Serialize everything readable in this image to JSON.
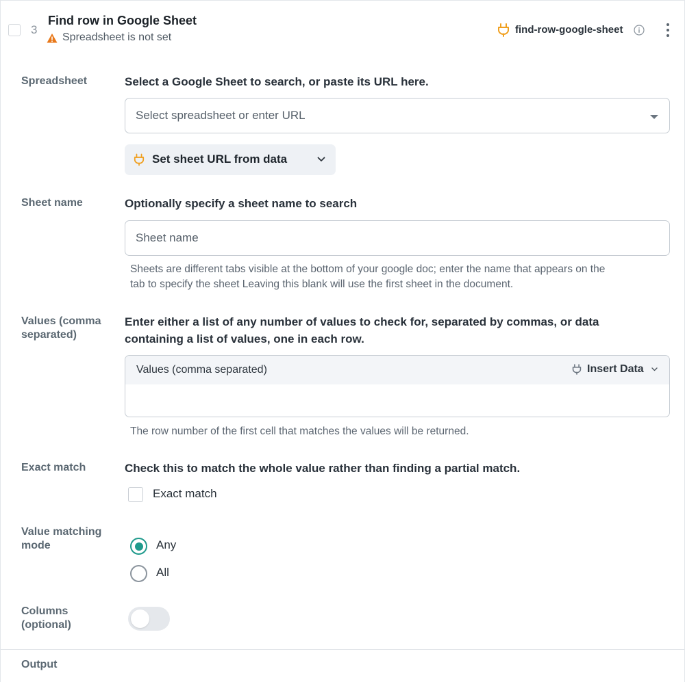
{
  "step": {
    "number": "3",
    "title": "Find row in Google Sheet",
    "warning": "Spreadsheet is not set",
    "slug": "find-row-google-sheet"
  },
  "fields": {
    "spreadsheet": {
      "label": "Spreadsheet",
      "description": "Select a Google Sheet to search, or paste its URL here.",
      "placeholder": "Select spreadsheet or enter URL",
      "data_button": "Set sheet URL from data"
    },
    "sheet_name": {
      "label": "Sheet name",
      "description": "Optionally specify a sheet name to search",
      "placeholder": "Sheet name",
      "help_line1": "Sheets are different tabs visible at the bottom of your google doc; enter the name that appears on the",
      "help_line2": "tab to specify the sheet Leaving this blank will use the first sheet in the document."
    },
    "values": {
      "label_line1": "Values (comma",
      "label_line2": "separated)",
      "description_line1": "Enter either a list of any number of values to check for, separated by commas, or data",
      "description_line2": "containing a list of values, one in each row.",
      "box_title": "Values (comma separated)",
      "insert_data": "Insert Data",
      "help": "The row number of the first cell that matches the values will be returned."
    },
    "exact_match": {
      "label": "Exact match",
      "description": "Check this to match the whole value rather than finding a partial match.",
      "checkbox_label": "Exact match",
      "checked": false
    },
    "value_matching_mode": {
      "label_line1": "Value matching",
      "label_line2": "mode",
      "options": [
        "Any",
        "All"
      ],
      "selected": "Any"
    },
    "columns": {
      "label_line1": "Columns",
      "label_line2": "(optional)",
      "enabled": false
    }
  },
  "output": {
    "label": "Output"
  },
  "colors": {
    "accent": "#1f9a8c",
    "plug": "#f0a020",
    "warning": "#e8781a"
  }
}
